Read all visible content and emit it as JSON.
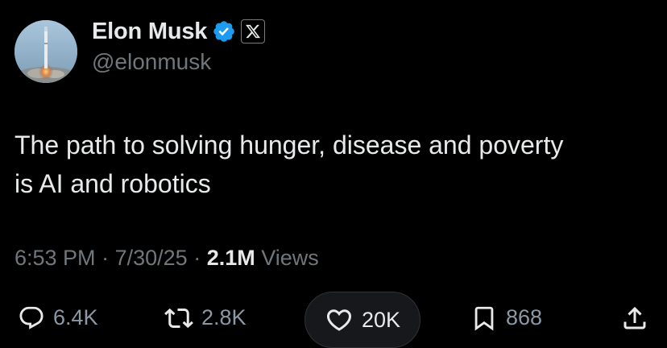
{
  "author": {
    "display_name": "Elon Musk",
    "handle": "@elonmusk",
    "verified_icon": "verified-badge-icon",
    "affiliate_icon": "x-logo-icon"
  },
  "tweet": {
    "text_lines": [
      "The path to solving hunger, disease and poverty",
      "is AI and robotics"
    ]
  },
  "meta": {
    "time": "6:53 PM",
    "separator": "·",
    "date": "7/30/25",
    "views_count": "2.1M",
    "views_label": "Views"
  },
  "actions": {
    "replies": "6.4K",
    "reposts": "2.8K",
    "likes": "20K",
    "bookmarks": "868"
  },
  "colors": {
    "background": "#000000",
    "text_primary": "#e7e9ea",
    "text_secondary": "#71767b",
    "verified_blue": "#1d9bf0"
  }
}
